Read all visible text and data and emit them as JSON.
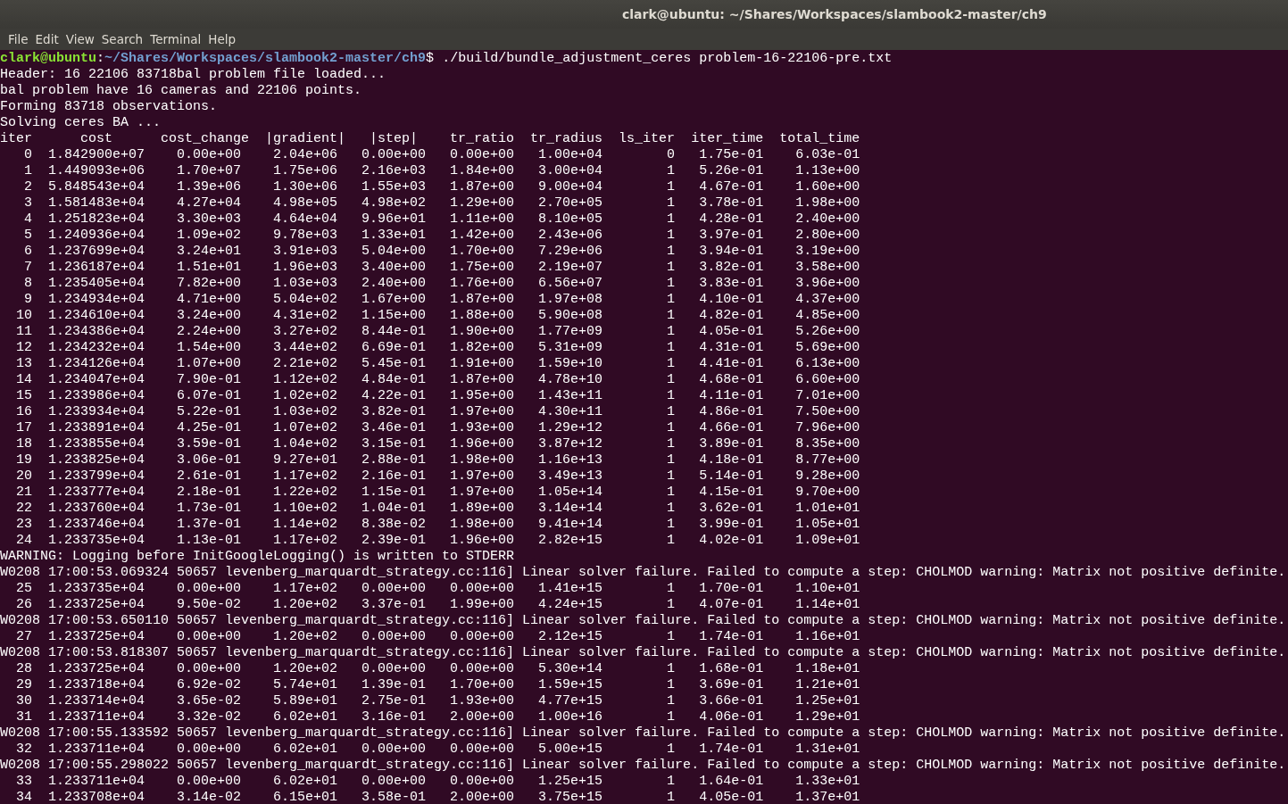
{
  "window": {
    "title": "clark@ubuntu: ~/Shares/Workspaces/slambook2-master/ch9"
  },
  "menu": [
    "File",
    "Edit",
    "View",
    "Search",
    "Terminal",
    "Help"
  ],
  "terminal": {
    "lines": [
      {
        "kind": "prompt",
        "user_host": "clark@ubuntu",
        "separator": ":",
        "symbol": "$",
        "path": "~/Shares/Workspaces/slambook2-master/ch9",
        "command": "./build/bundle_adjustment_ceres problem-16-22106-pre.txt"
      },
      {
        "kind": "text",
        "text": "Header: 16 22106 83718bal problem file loaded..."
      },
      {
        "kind": "text",
        "text": "bal problem have 16 cameras and 22106 points."
      },
      {
        "kind": "text",
        "text": "Forming 83718 observations."
      },
      {
        "kind": "text",
        "text": "Solving ceres BA ..."
      },
      {
        "kind": "text",
        "text": "iter      cost      cost_change  |gradient|   |step|    tr_ratio  tr_radius  ls_iter  iter_time  total_time"
      },
      {
        "kind": "row",
        "cells": [
          "0",
          "1.842900e+07",
          "0.00e+00",
          "2.04e+06",
          "0.00e+00",
          "0.00e+00",
          "1.00e+04",
          "0",
          "1.75e-01",
          "6.03e-01"
        ]
      },
      {
        "kind": "row",
        "cells": [
          "1",
          "1.449093e+06",
          "1.70e+07",
          "1.75e+06",
          "2.16e+03",
          "1.84e+00",
          "3.00e+04",
          "1",
          "5.26e-01",
          "1.13e+00"
        ]
      },
      {
        "kind": "row",
        "cells": [
          "2",
          "5.848543e+04",
          "1.39e+06",
          "1.30e+06",
          "1.55e+03",
          "1.87e+00",
          "9.00e+04",
          "1",
          "4.67e-01",
          "1.60e+00"
        ]
      },
      {
        "kind": "row",
        "cells": [
          "3",
          "1.581483e+04",
          "4.27e+04",
          "4.98e+05",
          "4.98e+02",
          "1.29e+00",
          "2.70e+05",
          "1",
          "3.78e-01",
          "1.98e+00"
        ]
      },
      {
        "kind": "row",
        "cells": [
          "4",
          "1.251823e+04",
          "3.30e+03",
          "4.64e+04",
          "9.96e+01",
          "1.11e+00",
          "8.10e+05",
          "1",
          "4.28e-01",
          "2.40e+00"
        ]
      },
      {
        "kind": "row",
        "cells": [
          "5",
          "1.240936e+04",
          "1.09e+02",
          "9.78e+03",
          "1.33e+01",
          "1.42e+00",
          "2.43e+06",
          "1",
          "3.97e-01",
          "2.80e+00"
        ]
      },
      {
        "kind": "row",
        "cells": [
          "6",
          "1.237699e+04",
          "3.24e+01",
          "3.91e+03",
          "5.04e+00",
          "1.70e+00",
          "7.29e+06",
          "1",
          "3.94e-01",
          "3.19e+00"
        ]
      },
      {
        "kind": "row",
        "cells": [
          "7",
          "1.236187e+04",
          "1.51e+01",
          "1.96e+03",
          "3.40e+00",
          "1.75e+00",
          "2.19e+07",
          "1",
          "3.82e-01",
          "3.58e+00"
        ]
      },
      {
        "kind": "row",
        "cells": [
          "8",
          "1.235405e+04",
          "7.82e+00",
          "1.03e+03",
          "2.40e+00",
          "1.76e+00",
          "6.56e+07",
          "1",
          "3.83e-01",
          "3.96e+00"
        ]
      },
      {
        "kind": "row",
        "cells": [
          "9",
          "1.234934e+04",
          "4.71e+00",
          "5.04e+02",
          "1.67e+00",
          "1.87e+00",
          "1.97e+08",
          "1",
          "4.10e-01",
          "4.37e+00"
        ]
      },
      {
        "kind": "row",
        "cells": [
          "10",
          "1.234610e+04",
          "3.24e+00",
          "4.31e+02",
          "1.15e+00",
          "1.88e+00",
          "5.90e+08",
          "1",
          "4.82e-01",
          "4.85e+00"
        ]
      },
      {
        "kind": "row",
        "cells": [
          "11",
          "1.234386e+04",
          "2.24e+00",
          "3.27e+02",
          "8.44e-01",
          "1.90e+00",
          "1.77e+09",
          "1",
          "4.05e-01",
          "5.26e+00"
        ]
      },
      {
        "kind": "row",
        "cells": [
          "12",
          "1.234232e+04",
          "1.54e+00",
          "3.44e+02",
          "6.69e-01",
          "1.82e+00",
          "5.31e+09",
          "1",
          "4.31e-01",
          "5.69e+00"
        ]
      },
      {
        "kind": "row",
        "cells": [
          "13",
          "1.234126e+04",
          "1.07e+00",
          "2.21e+02",
          "5.45e-01",
          "1.91e+00",
          "1.59e+10",
          "1",
          "4.41e-01",
          "6.13e+00"
        ]
      },
      {
        "kind": "row",
        "cells": [
          "14",
          "1.234047e+04",
          "7.90e-01",
          "1.12e+02",
          "4.84e-01",
          "1.87e+00",
          "4.78e+10",
          "1",
          "4.68e-01",
          "6.60e+00"
        ]
      },
      {
        "kind": "row",
        "cells": [
          "15",
          "1.233986e+04",
          "6.07e-01",
          "1.02e+02",
          "4.22e-01",
          "1.95e+00",
          "1.43e+11",
          "1",
          "4.11e-01",
          "7.01e+00"
        ]
      },
      {
        "kind": "row",
        "cells": [
          "16",
          "1.233934e+04",
          "5.22e-01",
          "1.03e+02",
          "3.82e-01",
          "1.97e+00",
          "4.30e+11",
          "1",
          "4.86e-01",
          "7.50e+00"
        ]
      },
      {
        "kind": "row",
        "cells": [
          "17",
          "1.233891e+04",
          "4.25e-01",
          "1.07e+02",
          "3.46e-01",
          "1.93e+00",
          "1.29e+12",
          "1",
          "4.66e-01",
          "7.96e+00"
        ]
      },
      {
        "kind": "row",
        "cells": [
          "18",
          "1.233855e+04",
          "3.59e-01",
          "1.04e+02",
          "3.15e-01",
          "1.96e+00",
          "3.87e+12",
          "1",
          "3.89e-01",
          "8.35e+00"
        ]
      },
      {
        "kind": "row",
        "cells": [
          "19",
          "1.233825e+04",
          "3.06e-01",
          "9.27e+01",
          "2.88e-01",
          "1.98e+00",
          "1.16e+13",
          "1",
          "4.18e-01",
          "8.77e+00"
        ]
      },
      {
        "kind": "row",
        "cells": [
          "20",
          "1.233799e+04",
          "2.61e-01",
          "1.17e+02",
          "2.16e-01",
          "1.97e+00",
          "3.49e+13",
          "1",
          "5.14e-01",
          "9.28e+00"
        ]
      },
      {
        "kind": "row",
        "cells": [
          "21",
          "1.233777e+04",
          "2.18e-01",
          "1.22e+02",
          "1.15e-01",
          "1.97e+00",
          "1.05e+14",
          "1",
          "4.15e-01",
          "9.70e+00"
        ]
      },
      {
        "kind": "row",
        "cells": [
          "22",
          "1.233760e+04",
          "1.73e-01",
          "1.10e+02",
          "1.04e-01",
          "1.89e+00",
          "3.14e+14",
          "1",
          "3.62e-01",
          "1.01e+01"
        ]
      },
      {
        "kind": "row",
        "cells": [
          "23",
          "1.233746e+04",
          "1.37e-01",
          "1.14e+02",
          "8.38e-02",
          "1.98e+00",
          "9.41e+14",
          "1",
          "3.99e-01",
          "1.05e+01"
        ]
      },
      {
        "kind": "row",
        "cells": [
          "24",
          "1.233735e+04",
          "1.13e-01",
          "1.17e+02",
          "2.39e-01",
          "1.96e+00",
          "2.82e+15",
          "1",
          "4.02e-01",
          "1.09e+01"
        ]
      },
      {
        "kind": "text",
        "text": "WARNING: Logging before InitGoogleLogging() is written to STDERR"
      },
      {
        "kind": "text",
        "text": "W0208 17:00:53.069324 50657 levenberg_marquardt_strategy.cc:116] Linear solver failure. Failed to compute a step: CHOLMOD warning: Matrix not positive definite."
      },
      {
        "kind": "row",
        "cells": [
          "25",
          "1.233735e+04",
          "0.00e+00",
          "1.17e+02",
          "0.00e+00",
          "0.00e+00",
          "1.41e+15",
          "1",
          "1.70e-01",
          "1.10e+01"
        ]
      },
      {
        "kind": "row",
        "cells": [
          "26",
          "1.233725e+04",
          "9.50e-02",
          "1.20e+02",
          "3.37e-01",
          "1.99e+00",
          "4.24e+15",
          "1",
          "4.07e-01",
          "1.14e+01"
        ]
      },
      {
        "kind": "text",
        "text": "W0208 17:00:53.650110 50657 levenberg_marquardt_strategy.cc:116] Linear solver failure. Failed to compute a step: CHOLMOD warning: Matrix not positive definite."
      },
      {
        "kind": "row",
        "cells": [
          "27",
          "1.233725e+04",
          "0.00e+00",
          "1.20e+02",
          "0.00e+00",
          "0.00e+00",
          "2.12e+15",
          "1",
          "1.74e-01",
          "1.16e+01"
        ]
      },
      {
        "kind": "text",
        "text": "W0208 17:00:53.818307 50657 levenberg_marquardt_strategy.cc:116] Linear solver failure. Failed to compute a step: CHOLMOD warning: Matrix not positive definite."
      },
      {
        "kind": "row",
        "cells": [
          "28",
          "1.233725e+04",
          "0.00e+00",
          "1.20e+02",
          "0.00e+00",
          "0.00e+00",
          "5.30e+14",
          "1",
          "1.68e-01",
          "1.18e+01"
        ]
      },
      {
        "kind": "row",
        "cells": [
          "29",
          "1.233718e+04",
          "6.92e-02",
          "5.74e+01",
          "1.39e-01",
          "1.70e+00",
          "1.59e+15",
          "1",
          "3.69e-01",
          "1.21e+01"
        ]
      },
      {
        "kind": "row",
        "cells": [
          "30",
          "1.233714e+04",
          "3.65e-02",
          "5.89e+01",
          "2.75e-01",
          "1.93e+00",
          "4.77e+15",
          "1",
          "3.66e-01",
          "1.25e+01"
        ]
      },
      {
        "kind": "row",
        "cells": [
          "31",
          "1.233711e+04",
          "3.32e-02",
          "6.02e+01",
          "3.16e-01",
          "2.00e+00",
          "1.00e+16",
          "1",
          "4.06e-01",
          "1.29e+01"
        ]
      },
      {
        "kind": "text",
        "text": "W0208 17:00:55.133592 50657 levenberg_marquardt_strategy.cc:116] Linear solver failure. Failed to compute a step: CHOLMOD warning: Matrix not positive definite."
      },
      {
        "kind": "row",
        "cells": [
          "32",
          "1.233711e+04",
          "0.00e+00",
          "6.02e+01",
          "0.00e+00",
          "0.00e+00",
          "5.00e+15",
          "1",
          "1.74e-01",
          "1.31e+01"
        ]
      },
      {
        "kind": "text",
        "text": "W0208 17:00:55.298022 50657 levenberg_marquardt_strategy.cc:116] Linear solver failure. Failed to compute a step: CHOLMOD warning: Matrix not positive definite."
      },
      {
        "kind": "row",
        "cells": [
          "33",
          "1.233711e+04",
          "0.00e+00",
          "6.02e+01",
          "0.00e+00",
          "0.00e+00",
          "1.25e+15",
          "1",
          "1.64e-01",
          "1.33e+01"
        ]
      },
      {
        "kind": "row",
        "cells": [
          "34",
          "1.233708e+04",
          "3.14e-02",
          "6.15e+01",
          "3.58e-01",
          "2.00e+00",
          "3.75e+15",
          "1",
          "4.05e-01",
          "1.37e+01"
        ]
      }
    ]
  }
}
